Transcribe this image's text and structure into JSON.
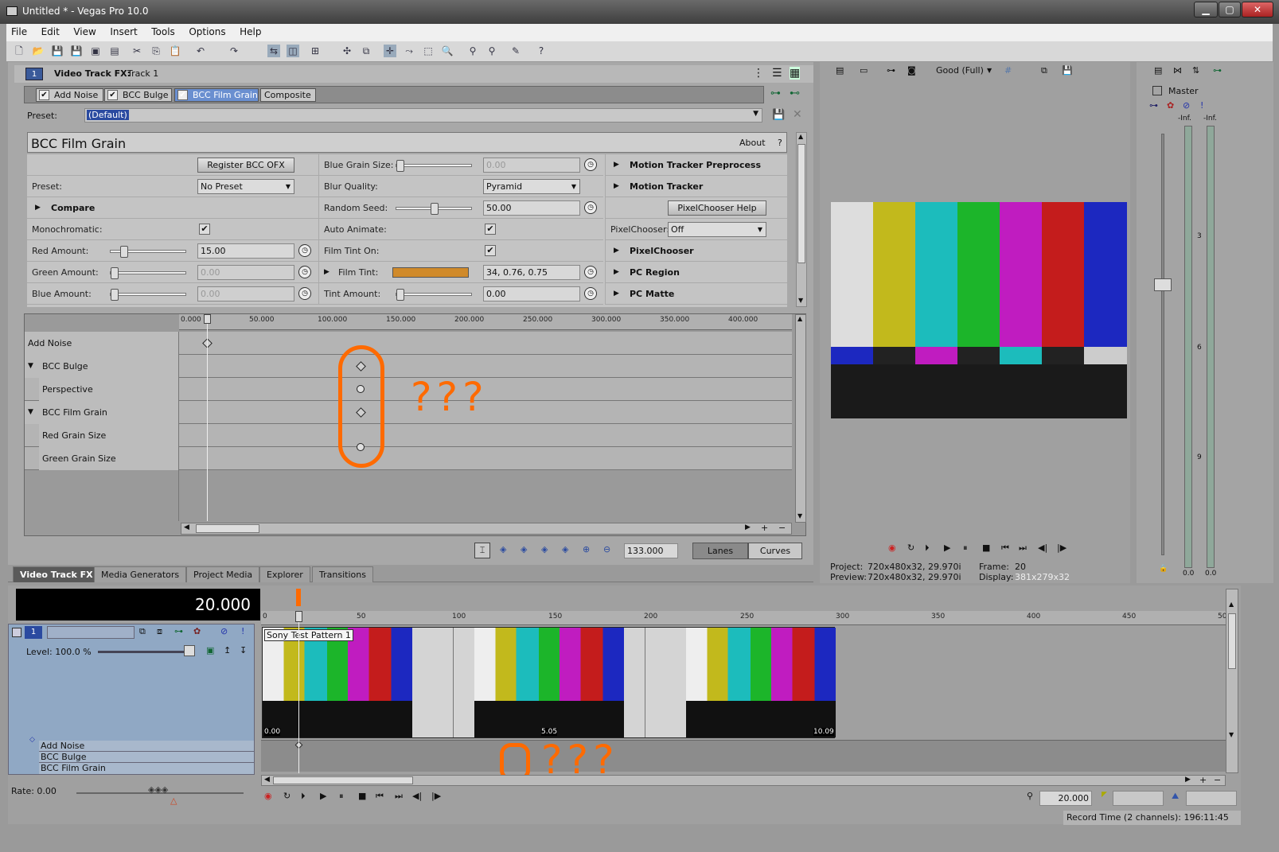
{
  "window": {
    "title": "Untitled * - Vegas Pro 10.0"
  },
  "menu": [
    "File",
    "Edit",
    "View",
    "Insert",
    "Tools",
    "Options",
    "Help"
  ],
  "fx_header": {
    "badge": "1",
    "title": "Video Track FX:",
    "track": "Track 1"
  },
  "fx_chain": [
    "Add Noise",
    "BCC Bulge",
    "BCC Film Grain",
    "Composite"
  ],
  "preset": {
    "label": "Preset:",
    "value": "(Default)"
  },
  "plugin": {
    "name": "BCC Film Grain",
    "about": "About",
    "help": "?"
  },
  "col1": {
    "register_button": "Register BCC OFX",
    "preset_label": "Preset:",
    "preset_value": "No Preset",
    "compare": "Compare",
    "monochromatic_label": "Monochromatic:",
    "red_amount_label": "Red Amount:",
    "red_amount_value": "15.00",
    "green_amount_label": "Green Amount:",
    "green_amount_value": "0.00",
    "blue_amount_label": "Blue Amount:",
    "blue_amount_value": "0.00"
  },
  "col2": {
    "blue_grain_size_label": "Blue Grain Size:",
    "blue_grain_size_value": "0.00",
    "blur_quality_label": "Blur Quality:",
    "blur_quality_value": "Pyramid",
    "random_seed_label": "Random Seed:",
    "random_seed_value": "50.00",
    "auto_animate_label": "Auto Animate:",
    "film_tint_on_label": "Film Tint On:",
    "film_tint_label": "Film Tint:",
    "film_tint_value": "34, 0.76, 0.75",
    "film_tint_color": "#d08a2a",
    "tint_amount_label": "Tint Amount:",
    "tint_amount_value": "0.00"
  },
  "col3": {
    "motion_tracker_preprocess": "Motion Tracker Preprocess",
    "motion_tracker": "Motion Tracker",
    "pixelchooser_help": "PixelChooser Help",
    "pixelchooser_label": "PixelChooser:",
    "pixelchooser_value": "Off",
    "pixelchooser": "PixelChooser",
    "pc_region": "PC Region",
    "pc_matte": "PC Matte"
  },
  "keyframes": {
    "ruler": [
      "0.000",
      "50.000",
      "100.000",
      "150.000",
      "200.000",
      "250.000",
      "300.000",
      "350.000",
      "400.000"
    ],
    "rows": [
      "Add Noise",
      "BCC Bulge",
      "Perspective",
      "BCC Film Grain",
      "Red Grain Size",
      "Green Grain Size"
    ],
    "time_value": "133.000",
    "lanes": "Lanes",
    "curves": "Curves"
  },
  "annotation": {
    "text": "???",
    "color": "#ff6a00"
  },
  "tabs": [
    "Video Track FX",
    "Media Generators",
    "Project Media",
    "Explorer",
    "Transitions"
  ],
  "preview": {
    "quality": "Good (Full)",
    "project_label": "Project:",
    "project_value": "720x480x32, 29.970i",
    "preview_label": "Preview:",
    "preview_value": "720x480x32, 29.970i",
    "frame_label": "Frame:",
    "frame_value": "20",
    "display_label": "Display:",
    "display_value": "381x279x32"
  },
  "mixer": {
    "master": "Master",
    "inf_l": "-Inf.",
    "inf_r": "-Inf.",
    "s3": "3",
    "s6": "6",
    "s9": "9",
    "zero_l": "0.0",
    "zero_r": "0.0"
  },
  "timeline": {
    "counter": "20.000",
    "track_badge": "1",
    "level": "Level: 100.0 %",
    "ruler": [
      "0",
      "50",
      "100",
      "150",
      "200",
      "250",
      "300",
      "350",
      "400",
      "450",
      "50"
    ],
    "clip_name": "Sony Test Pattern 1",
    "clip_t0": "0.00",
    "clip_t1": "5.05",
    "clip_t2": "10.09",
    "fx_rows": [
      "Add Noise",
      "BCC Bulge",
      "BCC Film Grain"
    ],
    "rate": "Rate: 0.00",
    "cursor_value": "20.000",
    "record_time": "Record Time (2 channels): 196:11:45"
  }
}
